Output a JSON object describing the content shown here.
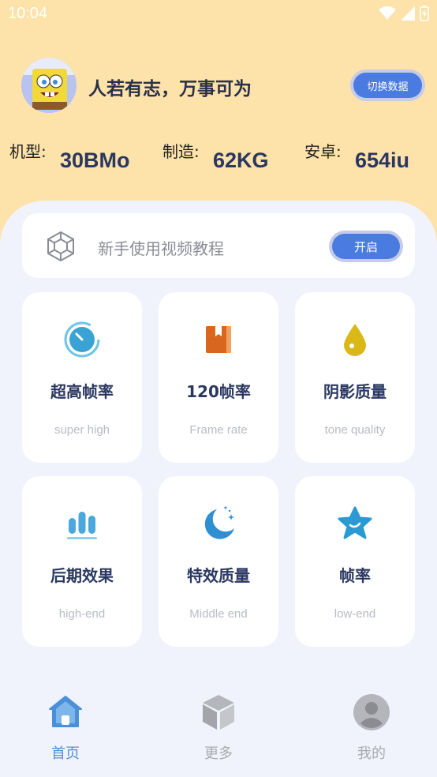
{
  "status": {
    "time": "10:04"
  },
  "header": {
    "slogan": "人若有志，万事可为",
    "switch_label": "切换数据",
    "specs": [
      {
        "label": "机型:",
        "value": "30BMo"
      },
      {
        "label": "制造:",
        "value": "62KG"
      },
      {
        "label": "安卓:",
        "value": "654iu"
      }
    ]
  },
  "tutorial": {
    "text": "新手使用视频教程",
    "button": "开启"
  },
  "tiles": [
    {
      "title": "超高帧率",
      "sub": "super high",
      "icon": "timer-icon"
    },
    {
      "title": "120帧率",
      "sub": "Frame rate",
      "icon": "book-icon"
    },
    {
      "title": "阴影质量",
      "sub": "tone quality",
      "icon": "drop-icon"
    },
    {
      "title": "后期效果",
      "sub": "high-end",
      "icon": "bar-chart-icon"
    },
    {
      "title": "特效质量",
      "sub": "Middle end",
      "icon": "moon-icon"
    },
    {
      "title": "帧率",
      "sub": "low-end",
      "icon": "star-icon"
    }
  ],
  "nav": [
    {
      "label": "首页",
      "icon": "home-icon",
      "active": true
    },
    {
      "label": "更多",
      "icon": "cube-icon",
      "active": false
    },
    {
      "label": "我的",
      "icon": "user-icon",
      "active": false
    }
  ],
  "colors": {
    "accent": "#4a7be0",
    "active_nav": "#4a90d9",
    "inactive_nav": "#a9abb2",
    "header_bg": "#fde2a9"
  }
}
